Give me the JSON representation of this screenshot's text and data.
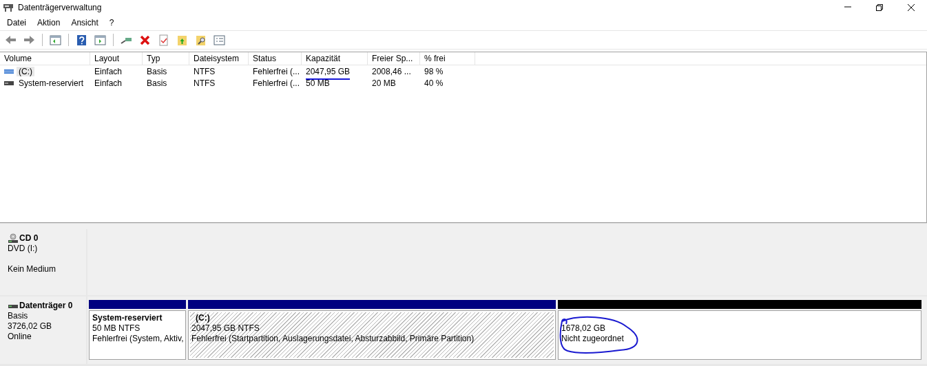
{
  "window": {
    "title": "Datenträgerverwaltung"
  },
  "menu": [
    "Datei",
    "Aktion",
    "Ansicht",
    "?"
  ],
  "table": {
    "columns": [
      "Volume",
      "Layout",
      "Typ",
      "Dateisystem",
      "Status",
      "Kapazität",
      "Freier Sp...",
      "% frei"
    ],
    "rows": [
      {
        "kind": "striped",
        "selected": true,
        "capacity_underlined": true,
        "cells": [
          "(C:)",
          "Einfach",
          "Basis",
          "NTFS",
          "Fehlerfrei (...",
          "2047,95 GB",
          "2008,46 ...",
          "98 %"
        ]
      },
      {
        "kind": "plain",
        "selected": false,
        "capacity_underlined": false,
        "cells": [
          "System-reserviert",
          "Einfach",
          "Basis",
          "NTFS",
          "Fehlerfrei (...",
          "50 MB",
          "20 MB",
          "40 %"
        ]
      }
    ]
  },
  "disks": [
    {
      "kind": "cd",
      "name": "CD 0",
      "lines": [
        "DVD (I:)",
        "Kein Medium"
      ]
    },
    {
      "kind": "disk",
      "name": "Datenträger 0",
      "lines": [
        "Basis",
        "3726,02 GB",
        "Online"
      ],
      "partitions": [
        {
          "kind": "primary",
          "selected": false,
          "circled": false,
          "title": "System-reserviert",
          "lines": [
            "50 MB NTFS",
            "Fehlerfrei (System, Aktiv,"
          ]
        },
        {
          "kind": "primary",
          "selected": true,
          "circled": false,
          "title": "(C:)",
          "lines": [
            "2047,95 GB NTFS",
            "Fehlerfrei (Startpartition, Auslagerungsdatei, Absturzabbild, Primäre Partition)"
          ]
        },
        {
          "kind": "unallocated",
          "selected": false,
          "circled": true,
          "lines": [
            "1678,02 GB",
            "Nicht zugeordnet"
          ]
        }
      ]
    }
  ]
}
